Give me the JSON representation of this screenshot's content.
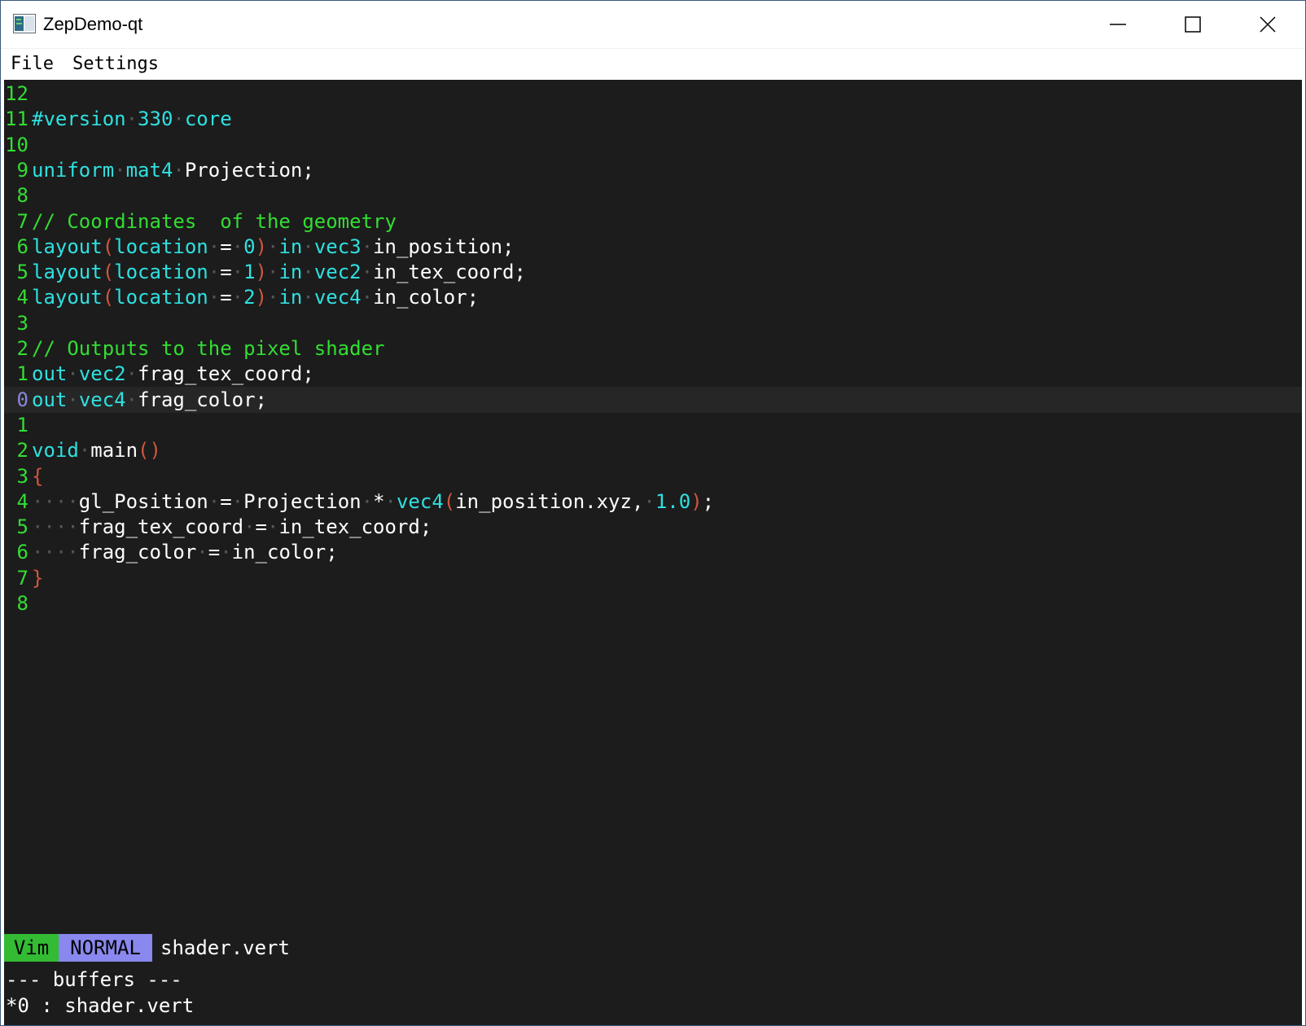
{
  "window": {
    "title": "ZepDemo-qt"
  },
  "menu": {
    "items": [
      "File",
      "Settings"
    ]
  },
  "editor": {
    "current_line_index": 12,
    "lines": [
      {
        "num": "12",
        "tokens": []
      },
      {
        "num": "11",
        "tokens": [
          [
            "kw",
            "#version"
          ],
          [
            "ws",
            " "
          ],
          [
            "kw",
            "330"
          ],
          [
            "ws",
            " "
          ],
          [
            "kw",
            "core"
          ]
        ]
      },
      {
        "num": "10",
        "tokens": []
      },
      {
        "num": "9",
        "tokens": [
          [
            "kw",
            "uniform"
          ],
          [
            "ws",
            " "
          ],
          [
            "kw",
            "mat4"
          ],
          [
            "ws",
            " "
          ],
          [
            "tx",
            "Projection;"
          ]
        ]
      },
      {
        "num": "8",
        "tokens": []
      },
      {
        "num": "7",
        "tokens": [
          [
            "cm",
            "// Coordinates  of the geometry"
          ]
        ]
      },
      {
        "num": "6",
        "tokens": [
          [
            "kw",
            "layout"
          ],
          [
            "br",
            "("
          ],
          [
            "kw",
            "location"
          ],
          [
            "ws",
            " "
          ],
          [
            "tx",
            "="
          ],
          [
            "ws",
            " "
          ],
          [
            "kw",
            "0"
          ],
          [
            "br",
            ")"
          ],
          [
            "ws",
            " "
          ],
          [
            "kw",
            "in"
          ],
          [
            "ws",
            " "
          ],
          [
            "kw",
            "vec3"
          ],
          [
            "ws",
            " "
          ],
          [
            "tx",
            "in_position;"
          ]
        ]
      },
      {
        "num": "5",
        "tokens": [
          [
            "kw",
            "layout"
          ],
          [
            "br",
            "("
          ],
          [
            "kw",
            "location"
          ],
          [
            "ws",
            " "
          ],
          [
            "tx",
            "="
          ],
          [
            "ws",
            " "
          ],
          [
            "kw",
            "1"
          ],
          [
            "br",
            ")"
          ],
          [
            "ws",
            " "
          ],
          [
            "kw",
            "in"
          ],
          [
            "ws",
            " "
          ],
          [
            "kw",
            "vec2"
          ],
          [
            "ws",
            " "
          ],
          [
            "tx",
            "in_tex_coord;"
          ]
        ]
      },
      {
        "num": "4",
        "tokens": [
          [
            "kw",
            "layout"
          ],
          [
            "br",
            "("
          ],
          [
            "kw",
            "location"
          ],
          [
            "ws",
            " "
          ],
          [
            "tx",
            "="
          ],
          [
            "ws",
            " "
          ],
          [
            "kw",
            "2"
          ],
          [
            "br",
            ")"
          ],
          [
            "ws",
            " "
          ],
          [
            "kw",
            "in"
          ],
          [
            "ws",
            " "
          ],
          [
            "kw",
            "vec4"
          ],
          [
            "ws",
            " "
          ],
          [
            "tx",
            "in_color;"
          ]
        ]
      },
      {
        "num": "3",
        "tokens": []
      },
      {
        "num": "2",
        "tokens": [
          [
            "cm",
            "// Outputs to the pixel shader"
          ]
        ]
      },
      {
        "num": "1",
        "tokens": [
          [
            "kw",
            "out"
          ],
          [
            "ws",
            " "
          ],
          [
            "kw",
            "vec2"
          ],
          [
            "ws",
            " "
          ],
          [
            "tx",
            "frag_tex_coord;"
          ]
        ]
      },
      {
        "num": "0",
        "tokens": [
          [
            "kw",
            "out"
          ],
          [
            "ws",
            " "
          ],
          [
            "kw",
            "vec4"
          ],
          [
            "ws",
            " "
          ],
          [
            "tx",
            "frag_color;"
          ]
        ]
      },
      {
        "num": "1",
        "tokens": []
      },
      {
        "num": "2",
        "tokens": [
          [
            "kw",
            "void"
          ],
          [
            "ws",
            " "
          ],
          [
            "tx",
            "main"
          ],
          [
            "br",
            "()"
          ]
        ]
      },
      {
        "num": "3",
        "tokens": [
          [
            "br",
            "{"
          ]
        ]
      },
      {
        "num": "4",
        "tokens": [
          [
            "ws",
            "    "
          ],
          [
            "tx",
            "gl_Position"
          ],
          [
            "ws",
            " "
          ],
          [
            "tx",
            "="
          ],
          [
            "ws",
            " "
          ],
          [
            "tx",
            "Projection"
          ],
          [
            "ws",
            " "
          ],
          [
            "tx",
            "*"
          ],
          [
            "ws",
            " "
          ],
          [
            "kw",
            "vec4"
          ],
          [
            "br",
            "("
          ],
          [
            "tx",
            "in_position.xyz,"
          ],
          [
            "ws",
            " "
          ],
          [
            "kw",
            "1.0"
          ],
          [
            "br",
            ")"
          ],
          [
            "tx",
            ";"
          ]
        ]
      },
      {
        "num": "5",
        "tokens": [
          [
            "ws",
            "    "
          ],
          [
            "tx",
            "frag_tex_coord"
          ],
          [
            "ws",
            " "
          ],
          [
            "tx",
            "="
          ],
          [
            "ws",
            " "
          ],
          [
            "tx",
            "in_tex_coord;"
          ]
        ]
      },
      {
        "num": "6",
        "tokens": [
          [
            "ws",
            "    "
          ],
          [
            "tx",
            "frag_color"
          ],
          [
            "ws",
            " "
          ],
          [
            "tx",
            "="
          ],
          [
            "ws",
            " "
          ],
          [
            "tx",
            "in_color;"
          ]
        ]
      },
      {
        "num": "7",
        "tokens": [
          [
            "br",
            "}"
          ]
        ]
      },
      {
        "num": "8",
        "tokens": []
      }
    ]
  },
  "status": {
    "mode_vim": "Vim",
    "mode_state": "NORMAL",
    "file": "shader.vert"
  },
  "command": {
    "lines": [
      "--- buffers ---",
      "*0 : shader.vert"
    ]
  },
  "colors": {
    "editor_bg": "#1c1c1c",
    "keyword": "#2fe0e0",
    "comment": "#33dd33",
    "bracket": "#d0573f",
    "line_number": "#33dd33",
    "current_line_number": "#8888dd",
    "vim_badge": "#33bb33",
    "normal_badge": "#8888ee"
  }
}
